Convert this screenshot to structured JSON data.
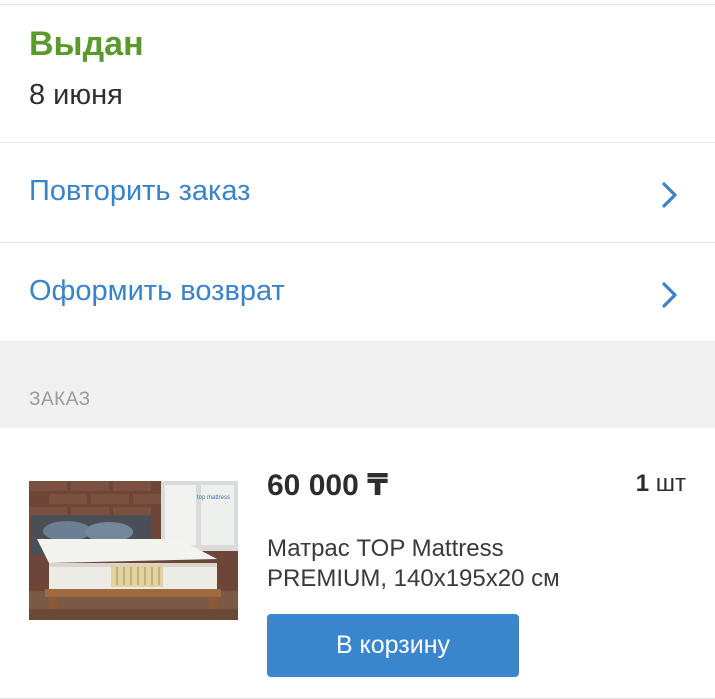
{
  "order_status": {
    "status": "Выдан",
    "date": "8 июня",
    "status_color": "#5a9a2c"
  },
  "actions": [
    {
      "label": "Повторить заказ",
      "icon": "chevron-right-icon"
    },
    {
      "label": "Оформить возврат",
      "icon": "chevron-right-icon"
    }
  ],
  "order_section": {
    "title": "ЗАКАЗ"
  },
  "order_item": {
    "price": "60 000 ₸",
    "quantity_number": "1",
    "quantity_unit": "шт",
    "name": "Матрас TOP Mattress PREMIUM, 140x195x20 см",
    "image": "mattress-product-photo",
    "image_logo_text": "top mattress",
    "add_to_cart_label": "В корзину"
  },
  "colors": {
    "accent": "#3a83c8",
    "button": "#3a86cc",
    "section_background": "#f0f0f0"
  }
}
